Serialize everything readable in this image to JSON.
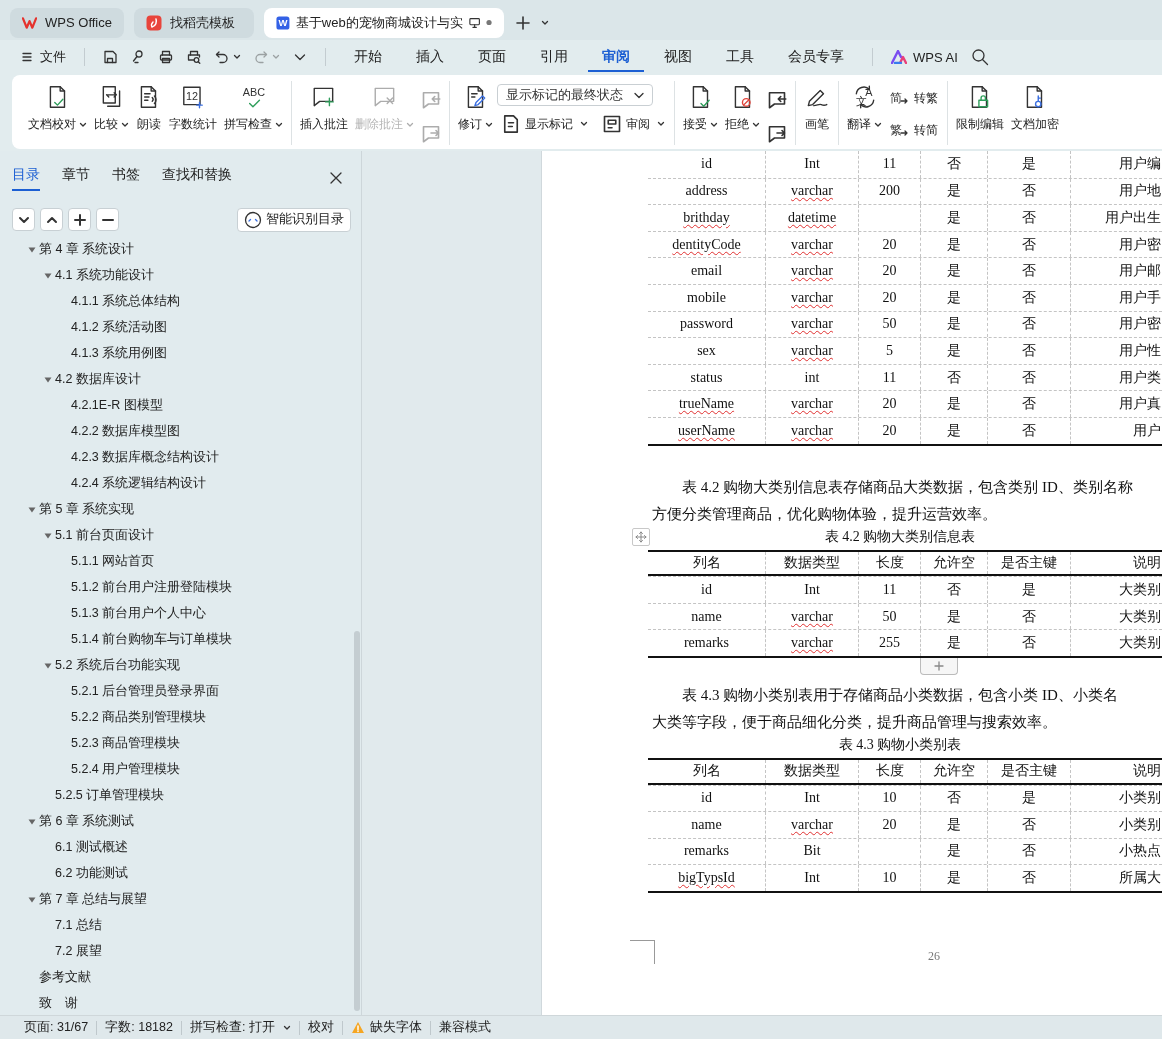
{
  "doc_tabs": [
    {
      "kind": "home",
      "label": "WPS Office",
      "selected": false
    },
    {
      "kind": "templates",
      "label": "找稻壳模板",
      "selected": false
    },
    {
      "kind": "document",
      "label": "基于web的宠物商城设计与实",
      "icon_text": "W",
      "selected": true,
      "unsaved": true
    }
  ],
  "menu": {
    "file_label": "文件",
    "quick_access": [
      {
        "disabled": false
      },
      {
        "disabled": false
      },
      {
        "disabled": false
      },
      {
        "disabled": false
      },
      {
        "disabled": false
      },
      {
        "disabled": true
      },
      {
        "disabled": false
      }
    ],
    "tabs": [
      {
        "label": "开始",
        "selected": false
      },
      {
        "label": "插入",
        "selected": false
      },
      {
        "label": "页面",
        "selected": false
      },
      {
        "label": "引用",
        "selected": false
      },
      {
        "label": "审阅",
        "selected": true
      },
      {
        "label": "视图",
        "selected": false
      },
      {
        "label": "工具",
        "selected": false
      },
      {
        "label": "会员专享",
        "selected": false
      }
    ],
    "ai_label": "WPS AI"
  },
  "ribbon": [
    {
      "items": [
        {
          "kind": "large",
          "label": "文档校对",
          "menu": true,
          "disabled": false
        },
        {
          "kind": "large",
          "label": "比较",
          "menu": true,
          "disabled": false
        },
        {
          "kind": "large",
          "label": "朗读",
          "menu": false,
          "disabled": false
        },
        {
          "kind": "large",
          "label": "字数统计",
          "menu": false,
          "disabled": false,
          "icon_text": "12"
        },
        {
          "kind": "large",
          "label": "拼写检查",
          "menu": true,
          "disabled": false,
          "icon_text": "ABC"
        }
      ]
    },
    {
      "items": [
        {
          "kind": "large",
          "label": "插入批注",
          "menu": false,
          "disabled": false
        },
        {
          "kind": "large",
          "label": "删除批注",
          "menu": true,
          "disabled": true
        },
        {
          "kind": "stack",
          "items": [
            {
              "kind": "small",
              "disabled": true
            },
            {
              "kind": "small",
              "disabled": true
            }
          ]
        }
      ]
    },
    {
      "items": [
        {
          "kind": "large",
          "label": "修订",
          "menu": true,
          "disabled": false
        },
        {
          "kind": "stack",
          "items": [
            {
              "kind": "select",
              "value": "显示标记的最终状态"
            },
            {
              "kind": "row",
              "items": [
                {
                  "kind": "small-text",
                  "label": "显示标记",
                  "menu": true,
                  "disabled": false
                },
                {
                  "kind": "small-text",
                  "label": "审阅",
                  "menu": true,
                  "disabled": false
                }
              ]
            }
          ]
        }
      ]
    },
    {
      "items": [
        {
          "kind": "large",
          "label": "接受",
          "menu": true,
          "disabled": false
        },
        {
          "kind": "large",
          "label": "拒绝",
          "menu": true,
          "disabled": false
        },
        {
          "kind": "stack",
          "items": [
            {
              "kind": "small",
              "disabled": false
            },
            {
              "kind": "small",
              "disabled": false
            }
          ]
        }
      ]
    },
    {
      "items": [
        {
          "kind": "large",
          "label": "画笔",
          "menu": false,
          "disabled": false
        }
      ]
    },
    {
      "items": [
        {
          "kind": "large",
          "label": "翻译",
          "menu": true,
          "disabled": false,
          "icon_text": "A文"
        },
        {
          "kind": "stack",
          "items": [
            {
              "kind": "small-text",
              "label": "转繁",
              "menu": false,
              "disabled": false,
              "icon_text": "简"
            },
            {
              "kind": "small-text",
              "label": "转简",
              "menu": false,
              "disabled": false,
              "icon_text": "繁"
            }
          ]
        }
      ]
    },
    {
      "items": [
        {
          "kind": "large",
          "label": "限制编辑",
          "menu": false,
          "disabled": false
        },
        {
          "kind": "large",
          "label": "文档加密",
          "menu": false,
          "disabled": false
        }
      ]
    }
  ],
  "sidebar": {
    "tabs": [
      {
        "label": "目录",
        "selected": true
      },
      {
        "label": "章节",
        "selected": false
      },
      {
        "label": "书签",
        "selected": false
      },
      {
        "label": "查找和替换",
        "selected": false
      }
    ],
    "smart_button": "智能识别目录",
    "toc": [
      {
        "label": "第 4 章  系统设计",
        "expanded": true,
        "children": [
          {
            "label": "4.1  系统功能设计",
            "expanded": true,
            "children": [
              {
                "label": "4.1.1 系统总体结构"
              },
              {
                "label": "4.1.2 系统活动图"
              },
              {
                "label": "4.1.3 系统用例图"
              }
            ]
          },
          {
            "label": "4.2 数据库设计",
            "expanded": true,
            "children": [
              {
                "label": "4.2.1E-R 图模型"
              },
              {
                "label": "4.2.2 数据库模型图"
              },
              {
                "label": "4.2.3 数据库概念结构设计"
              },
              {
                "label": "4.2.4 系统逻辑结构设计"
              }
            ]
          }
        ]
      },
      {
        "label": "第 5 章  系统实现",
        "expanded": true,
        "children": [
          {
            "label": "5.1 前台页面设计",
            "expanded": true,
            "children": [
              {
                "label": "5.1.1 网站首页"
              },
              {
                "label": "5.1.2 前台用户注册登陆模块"
              },
              {
                "label": "5.1.3 前台用户个人中心"
              },
              {
                "label": "5.1.4 前台购物车与订单模块"
              }
            ]
          },
          {
            "label": "5.2 系统后台功能实现",
            "expanded": true,
            "children": [
              {
                "label": "5.2.1 后台管理员登录界面"
              },
              {
                "label": "5.2.2 商品类别管理模块"
              },
              {
                "label": "5.2.3 商品管理模块"
              },
              {
                "label": "5.2.4 用户管理模块"
              }
            ]
          },
          {
            "label": "5.2.5 订单管理模块"
          }
        ]
      },
      {
        "label": "第 6 章  系统测试",
        "expanded": true,
        "children": [
          {
            "label": "6.1 测试概述"
          },
          {
            "label": "6.2 功能测试"
          }
        ]
      },
      {
        "label": "第 7 章  总结与展望",
        "expanded": true,
        "children": [
          {
            "label": "7.1 总结"
          },
          {
            "label": "7.2 展望"
          }
        ]
      },
      {
        "label": "参考文献"
      },
      {
        "label": "致　谢"
      }
    ]
  },
  "document": {
    "blocks": [
      {
        "kind": "table",
        "rows": [
          {
            "cells": [
              "id",
              "Int",
              "11",
              "否",
              "是",
              "用户编"
            ],
            "flagged": [
              false,
              false
            ]
          },
          {
            "cells": [
              "address",
              "varchar",
              "200",
              "是",
              "否",
              "用户地"
            ],
            "flagged": [
              false,
              true
            ]
          },
          {
            "cells": [
              "brithday",
              "datetime",
              "",
              "是",
              "否",
              "用户出生"
            ],
            "flagged": [
              true,
              true
            ]
          },
          {
            "cells": [
              "dentityCode",
              "varchar",
              "20",
              "是",
              "否",
              "用户密"
            ],
            "flagged": [
              true,
              true
            ]
          },
          {
            "cells": [
              "email",
              "varchar",
              "20",
              "是",
              "否",
              "用户邮"
            ],
            "flagged": [
              false,
              true
            ]
          },
          {
            "cells": [
              "mobile",
              "varchar",
              "20",
              "是",
              "否",
              "用户手"
            ],
            "flagged": [
              false,
              true
            ]
          },
          {
            "cells": [
              "password",
              "varchar",
              "50",
              "是",
              "否",
              "用户密"
            ],
            "flagged": [
              false,
              true
            ]
          },
          {
            "cells": [
              "sex",
              "varchar",
              "5",
              "是",
              "否",
              "用户性"
            ],
            "flagged": [
              false,
              true
            ]
          },
          {
            "cells": [
              "status",
              "int",
              "11",
              "否",
              "否",
              "用户类"
            ],
            "flagged": [
              false,
              false
            ]
          },
          {
            "cells": [
              "trueName",
              "varchar",
              "20",
              "是",
              "否",
              "用户真"
            ],
            "flagged": [
              true,
              true
            ]
          },
          {
            "cells": [
              "userName",
              "varchar",
              "20",
              "是",
              "否",
              "用户"
            ],
            "flagged": [
              true,
              true
            ]
          }
        ]
      },
      {
        "kind": "paragraph",
        "lines": [
          "表 4.2  购物大类别信息表存储商品大类数据，包含类别 ID、类别名称",
          "方便分类管理商品，优化购物体验，提升运营效率。"
        ]
      },
      {
        "kind": "caption",
        "text": "表 4.2  购物大类别信息表",
        "move_handle": true
      },
      {
        "kind": "table",
        "add_row_button": true,
        "columns": [
          "列名",
          "数据类型",
          "长度",
          "允许空",
          "是否主键",
          "说明"
        ],
        "rows": [
          {
            "cells": [
              "id",
              "Int",
              "11",
              "否",
              "是",
              "大类别"
            ],
            "flagged": [
              false,
              false
            ]
          },
          {
            "cells": [
              "name",
              "varchar",
              "50",
              "是",
              "否",
              "大类别"
            ],
            "flagged": [
              false,
              true
            ]
          },
          {
            "cells": [
              "remarks",
              "varchar",
              "255",
              "是",
              "否",
              "大类别"
            ],
            "flagged": [
              false,
              true
            ]
          }
        ]
      },
      {
        "kind": "paragraph",
        "lines": [
          "表 4.3  购物小类别表用于存储商品小类数据，包含小类 ID、小类名",
          "大类等字段，便于商品细化分类，提升商品管理与搜索效率。"
        ]
      },
      {
        "kind": "caption",
        "text": "表 4.3    购物小类别表"
      },
      {
        "kind": "table",
        "columns": [
          "列名",
          "数据类型",
          "长度",
          "允许空",
          "是否主键",
          "说明"
        ],
        "rows": [
          {
            "cells": [
              "id",
              "Int",
              "10",
              "否",
              "是",
              "小类别"
            ],
            "flagged": [
              false,
              false
            ]
          },
          {
            "cells": [
              "name",
              "varchar",
              "20",
              "是",
              "否",
              "小类别"
            ],
            "flagged": [
              false,
              true
            ]
          },
          {
            "cells": [
              "remarks",
              "Bit",
              "",
              "是",
              "否",
              "小热点"
            ],
            "flagged": [
              false,
              false
            ]
          },
          {
            "cells": [
              "bigTypsId",
              "Int",
              "10",
              "是",
              "否",
              "所属大"
            ],
            "flagged": [
              true,
              false
            ]
          }
        ]
      }
    ],
    "page_number": "26"
  },
  "status_bar": [
    {
      "kind": "text",
      "text": "页面: 31/67"
    },
    {
      "kind": "text",
      "text": "字数: 18182"
    },
    {
      "kind": "menu",
      "text": "拼写检查: 打开"
    },
    {
      "kind": "text",
      "text": "校对"
    },
    {
      "kind": "warning",
      "text": "缺失字体"
    },
    {
      "kind": "text",
      "text": "兼容模式"
    }
  ]
}
